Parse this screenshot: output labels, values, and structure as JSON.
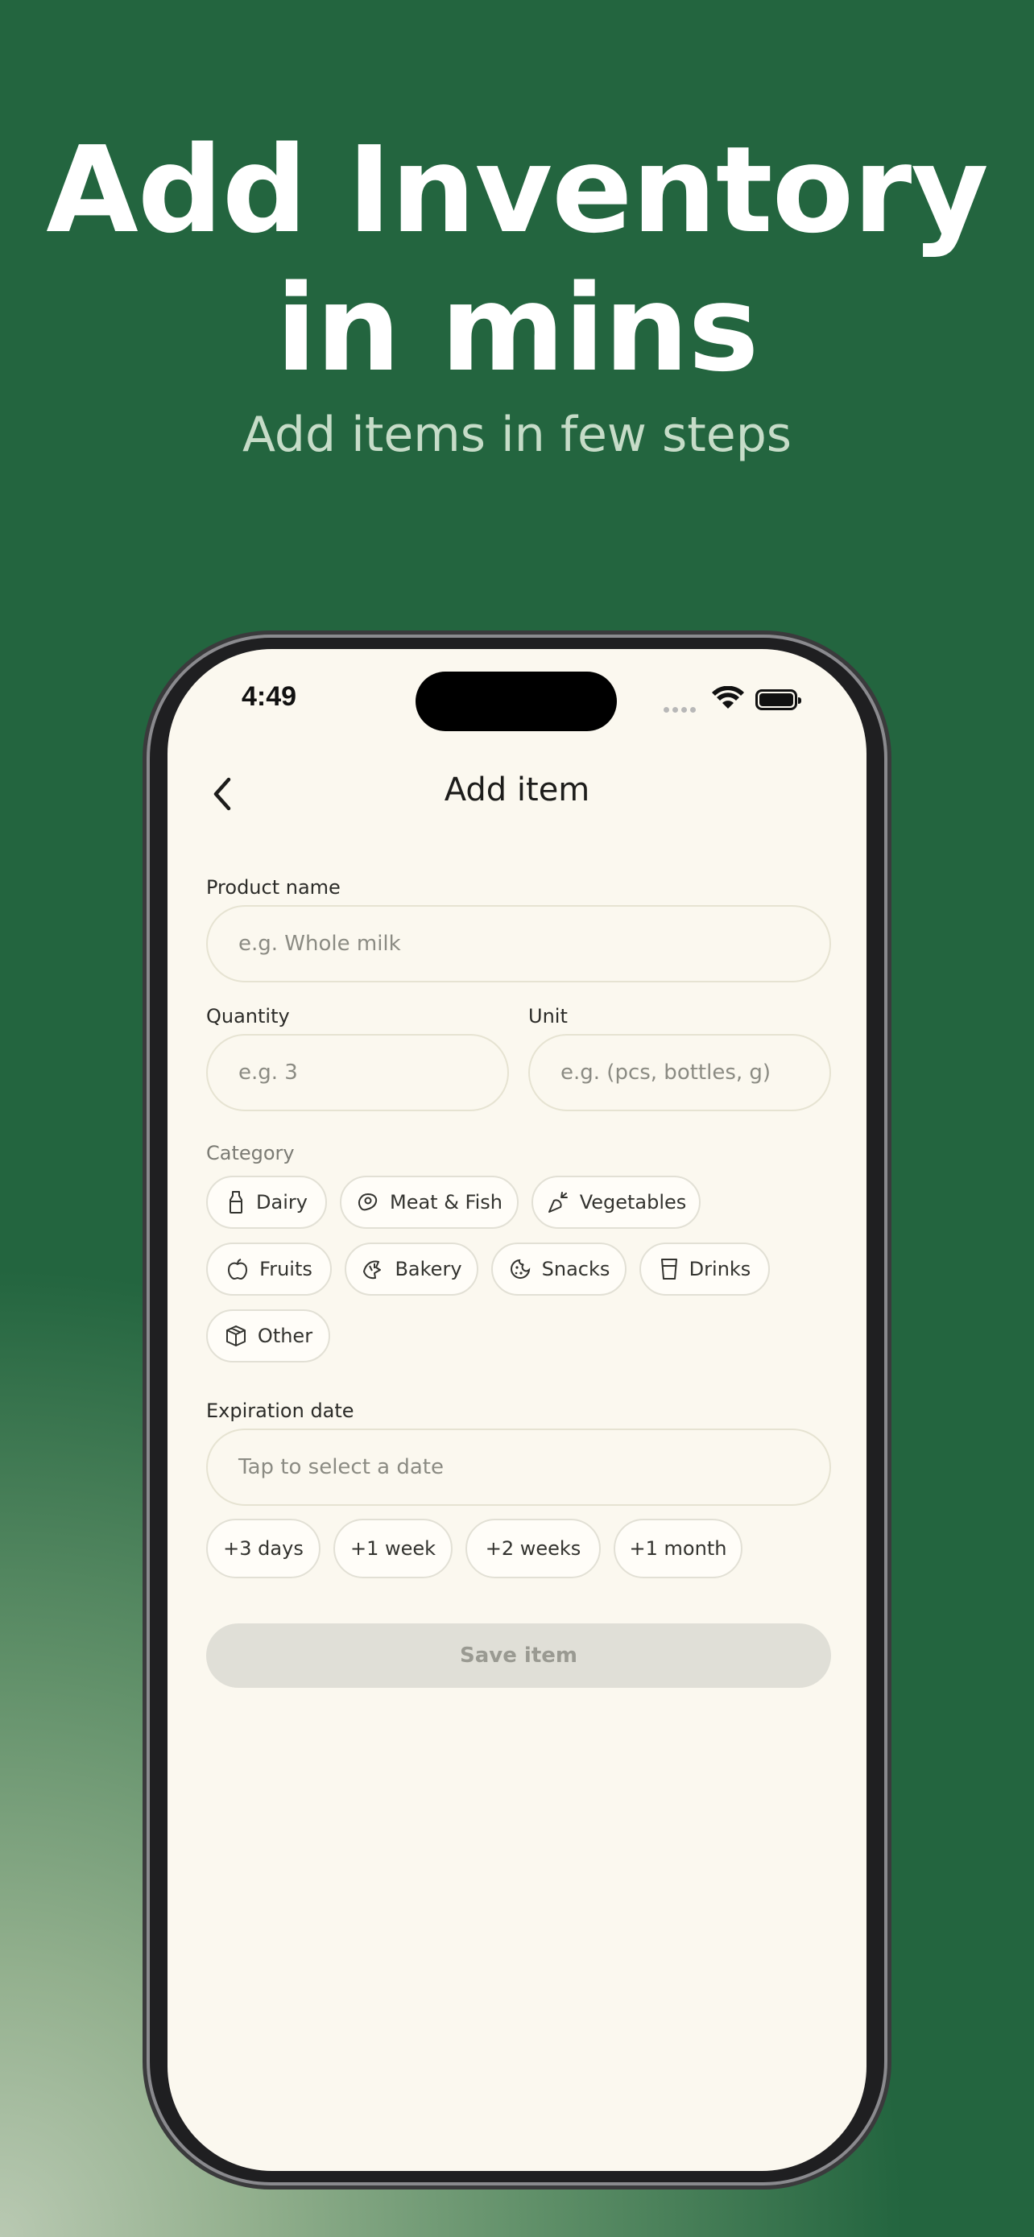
{
  "headline": {
    "line1": "Add Inventory",
    "line2": "in mins",
    "subtitle": "Add items in few steps"
  },
  "status": {
    "time": "4:49"
  },
  "nav": {
    "title": "Add item",
    "back_icon": "chevron-left-icon"
  },
  "form": {
    "product_name": {
      "label": "Product name",
      "placeholder": "e.g. Whole milk",
      "value": ""
    },
    "quantity": {
      "label": "Quantity",
      "placeholder": "e.g. 3",
      "value": ""
    },
    "unit": {
      "label": "Unit",
      "placeholder": "e.g. (pcs, bottles, g)",
      "value": ""
    },
    "category": {
      "label": "Category",
      "items": [
        {
          "label": "Dairy",
          "icon": "milk-bottle-icon"
        },
        {
          "label": "Meat & Fish",
          "icon": "steak-icon"
        },
        {
          "label": "Vegetables",
          "icon": "carrot-icon"
        },
        {
          "label": "Fruits",
          "icon": "apple-icon"
        },
        {
          "label": "Bakery",
          "icon": "croissant-icon"
        },
        {
          "label": "Snacks",
          "icon": "cookie-icon"
        },
        {
          "label": "Drinks",
          "icon": "glass-icon"
        },
        {
          "label": "Other",
          "icon": "box-icon"
        }
      ]
    },
    "expiration": {
      "label": "Expiration date",
      "placeholder": "Tap to select a date",
      "quick": [
        "+3 days",
        "+1 week",
        "+2 weeks",
        "+1 month"
      ]
    },
    "save_label": "Save item"
  },
  "colors": {
    "background_green": "#23653f",
    "screen_bg": "#fbf8ef",
    "field_border": "#e6e3d2",
    "save_disabled": "#e0dfd7"
  }
}
